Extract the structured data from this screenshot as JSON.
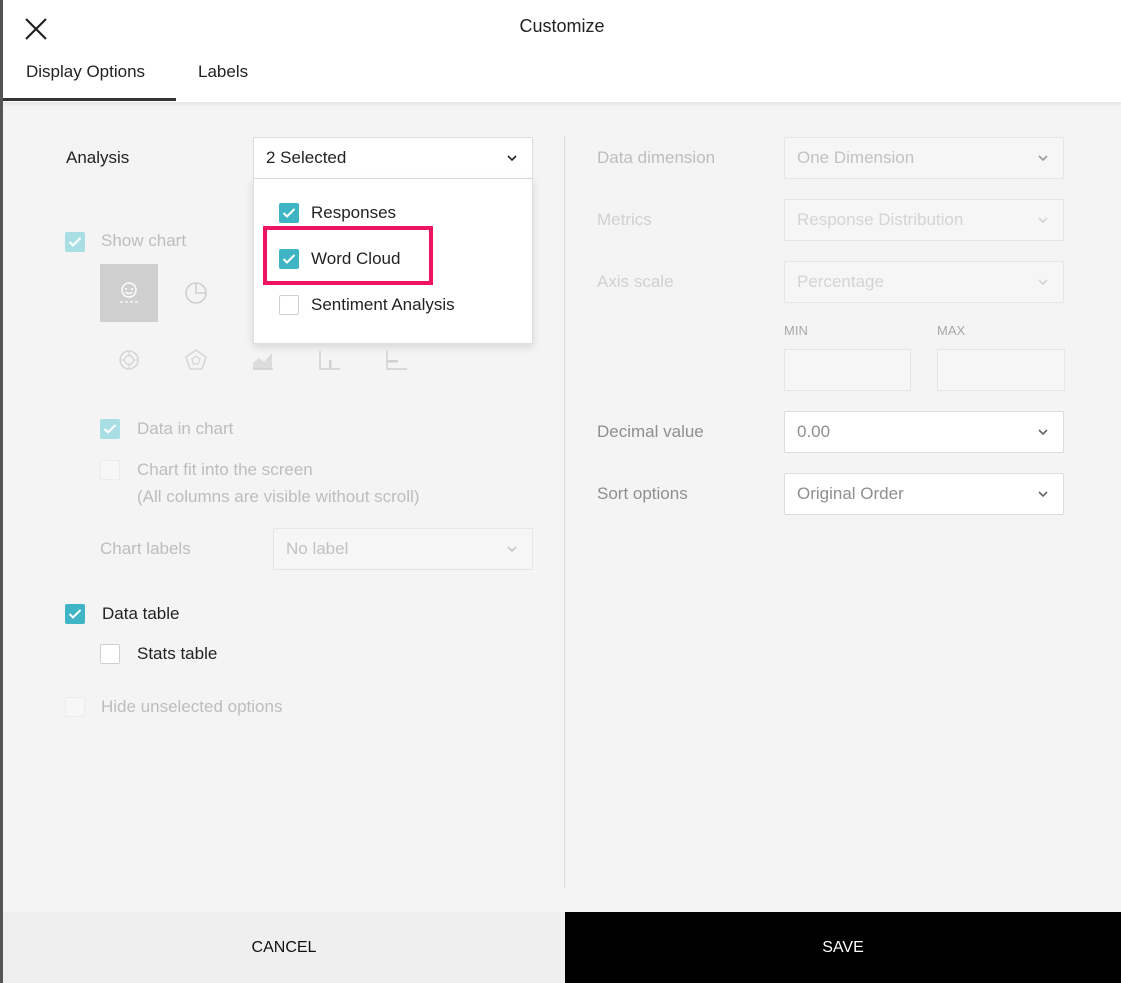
{
  "header": {
    "title": "Customize",
    "tabs": [
      {
        "label": "Display Options",
        "active": true
      },
      {
        "label": "Labels",
        "active": false
      }
    ]
  },
  "left": {
    "analysis": {
      "label": "Analysis",
      "value": "2 Selected",
      "options": [
        {
          "label": "Responses",
          "checked": true
        },
        {
          "label": "Word Cloud",
          "checked": true
        },
        {
          "label": "Sentiment Analysis",
          "checked": false
        }
      ]
    },
    "show_chart": {
      "label": "Show chart",
      "checked": true,
      "disabled": true
    },
    "chart_types": [
      "word-cloud-icon",
      "pie-chart-icon",
      "donut-chart-icon",
      "radar-chart-icon",
      "area-chart-icon",
      "column-chart-icon",
      "bar-chart-icon"
    ],
    "data_in_chart": {
      "label": "Data in chart",
      "checked": true,
      "disabled": true
    },
    "chart_fit": {
      "label": "Chart fit into the screen",
      "sublabel": "(All columns are visible without scroll)",
      "checked": false,
      "disabled": true
    },
    "chart_labels": {
      "label": "Chart labels",
      "value": "No label",
      "disabled": true
    },
    "data_table": {
      "label": "Data table",
      "checked": true
    },
    "stats_table": {
      "label": "Stats table",
      "checked": false
    },
    "hide_unselected": {
      "label": "Hide unselected options",
      "checked": false,
      "disabled": true
    }
  },
  "right": {
    "data_dimension": {
      "label": "Data dimension",
      "value": "One Dimension"
    },
    "metrics": {
      "label": "Metrics",
      "value": "Response Distribution"
    },
    "axis_scale": {
      "label": "Axis scale",
      "value": "Percentage",
      "min_label": "MIN",
      "max_label": "MAX"
    },
    "decimal_value": {
      "label": "Decimal value",
      "value": "0.00"
    },
    "sort_options": {
      "label": "Sort options",
      "value": "Original Order"
    }
  },
  "footer": {
    "cancel_label": "CANCEL",
    "save_label": "SAVE"
  },
  "colors": {
    "accent": "#3fb4c4",
    "highlight": "#ee1462",
    "save_bg": "#000000"
  }
}
